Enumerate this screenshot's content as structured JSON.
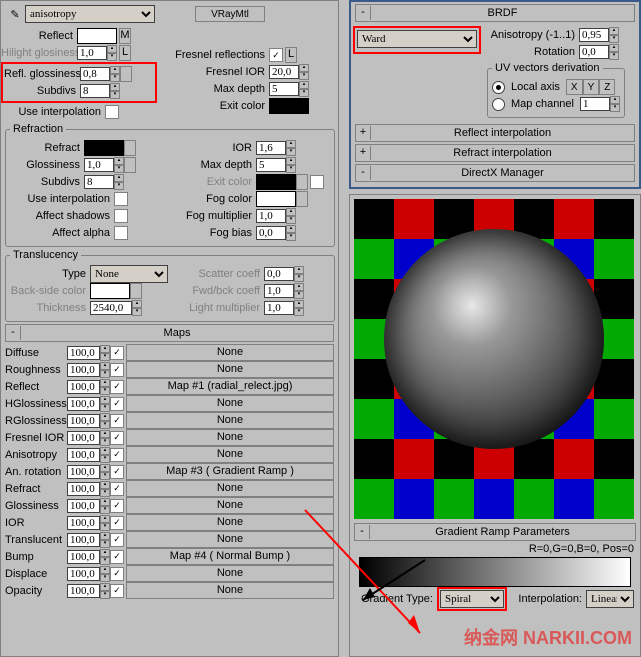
{
  "top": {
    "mat_name": "anisotropy",
    "mat_type": "VRayMtl"
  },
  "reflect": {
    "label": "Reflect",
    "m": "M",
    "hilight_gloss": "Hilight glosiness",
    "hilight_val": "1,0",
    "l": "L",
    "refl_gloss": "Refl. glossiness",
    "refl_val": "0,8",
    "subdivs": "Subdivs",
    "subdivs_val": "8",
    "use_interp": "Use interpolation",
    "fresnel_refl": "Fresnel reflections",
    "fresnel_ior": "Fresnel IOR",
    "fresnel_ior_val": "20,0",
    "max_depth": "Max depth",
    "max_depth_val": "5",
    "exit_color": "Exit color"
  },
  "refraction": {
    "legend": "Refraction",
    "refract": "Refract",
    "gloss": "Glossiness",
    "gloss_val": "1,0",
    "subdivs": "Subdivs",
    "subdivs_val": "8",
    "use_interp": "Use interpolation",
    "aff_shadows": "Affect shadows",
    "aff_alpha": "Affect alpha",
    "ior": "IOR",
    "ior_val": "1,6",
    "max_depth": "Max depth",
    "max_depth_val": "5",
    "exit_color": "Exit color",
    "fog_color": "Fog color",
    "fog_mult": "Fog multiplier",
    "fog_mult_val": "1,0",
    "fog_bias": "Fog bias",
    "fog_bias_val": "0,0"
  },
  "trans": {
    "legend": "Translucency",
    "type": "Type",
    "type_val": "None",
    "back": "Back-side color",
    "thick": "Thickness",
    "thick_val": "2540,0",
    "scatter": "Scatter coeff",
    "scatter_val": "0,0",
    "fwd": "Fwd/bck coeff",
    "fwd_val": "1,0",
    "light": "Light multiplier",
    "light_val": "1,0"
  },
  "maps": {
    "title": "Maps",
    "rows": [
      {
        "name": "Diffuse",
        "val": "100,0",
        "btn": "None"
      },
      {
        "name": "Roughness",
        "val": "100,0",
        "btn": "None"
      },
      {
        "name": "Reflect",
        "val": "100,0",
        "btn": "Map #1 (radial_relect.jpg)"
      },
      {
        "name": "HGlossiness",
        "val": "100,0",
        "btn": "None"
      },
      {
        "name": "RGlossiness",
        "val": "100,0",
        "btn": "None"
      },
      {
        "name": "Fresnel IOR",
        "val": "100,0",
        "btn": "None"
      },
      {
        "name": "Anisotropy",
        "val": "100,0",
        "btn": "None"
      },
      {
        "name": "An. rotation",
        "val": "100,0",
        "btn": "Map #3  ( Gradient Ramp )"
      },
      {
        "name": "Refract",
        "val": "100,0",
        "btn": "None"
      },
      {
        "name": "Glossiness",
        "val": "100,0",
        "btn": "None"
      },
      {
        "name": "IOR",
        "val": "100,0",
        "btn": "None"
      },
      {
        "name": "Translucent",
        "val": "100,0",
        "btn": "None"
      },
      {
        "name": "Bump",
        "val": "100,0",
        "btn": "Map #4  ( Normal Bump )"
      },
      {
        "name": "Displace",
        "val": "100,0",
        "btn": "None"
      },
      {
        "name": "Opacity",
        "val": "100,0",
        "btn": "None"
      }
    ]
  },
  "brdf": {
    "title": "BRDF",
    "type": "Ward",
    "aniso": "Anisotropy (-1..1)",
    "aniso_val": "0,95",
    "rot": "Rotation",
    "rot_val": "0,0",
    "uv_legend": "UV vectors derivation",
    "local": "Local axis",
    "x": "X",
    "y": "Y",
    "z": "Z",
    "mapch": "Map channel",
    "mapch_val": "1",
    "r_interp": "Reflect interpolation",
    "rf_interp": "Refract interpolation",
    "dx": "DirectX Manager"
  },
  "grad": {
    "title": "Gradient Ramp Parameters",
    "info": "R=0,G=0,B=0, Pos=0",
    "gtype": "Gradient Type:",
    "gtype_val": "Spiral",
    "interp": "Interpolation:",
    "interp_val": "Linear"
  },
  "watermark": "纳金网 NARKII.COM"
}
